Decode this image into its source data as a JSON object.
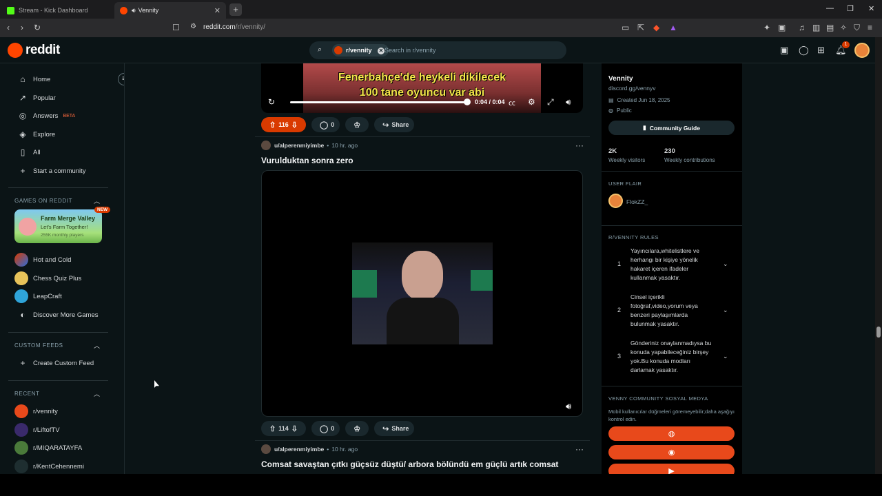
{
  "browser": {
    "tabs": [
      {
        "label": "Stream - Kick Dashboard",
        "favicon_color": "#53fc18"
      },
      {
        "label": "Vennity",
        "favicon_color": "#ff4500"
      }
    ],
    "new_tab": "+",
    "window_controls": {
      "minimize": "—",
      "restore": "❐",
      "close": "✕"
    },
    "url_host": "reddit.com",
    "url_path": "/r/vennity/"
  },
  "header": {
    "logo_text": "reddit",
    "search_chip": "r/vennity",
    "search_placeholder": "Search in r/vennity",
    "notification_count": "1"
  },
  "sidebar": {
    "nav": [
      {
        "label": "Home",
        "icon": "home-icon"
      },
      {
        "label": "Popular",
        "icon": "popular-icon"
      },
      {
        "label": "Answers",
        "icon": "answers-icon",
        "badge": "BETA"
      },
      {
        "label": "Explore",
        "icon": "explore-icon"
      },
      {
        "label": "All",
        "icon": "all-icon"
      },
      {
        "label": "Start a community",
        "icon": "plus-icon"
      }
    ],
    "games_title": "GAMES ON REDDIT",
    "featured_game": {
      "title": "Farm Merge Valley",
      "tagline": "Let's Farm Together!",
      "players": "255K monthly players",
      "badge": "NEW"
    },
    "games": [
      "Hot and Cold",
      "Chess Quiz Plus",
      "LeapCraft",
      "Discover More Games"
    ],
    "custom_feeds_title": "CUSTOM FEEDS",
    "create_feed": "Create Custom Feed",
    "recent_title": "RECENT",
    "recent": [
      "r/vennity",
      "r/LiftofTV",
      "r/MIQARATAYFA",
      "r/KentCehennemi"
    ]
  },
  "feed": {
    "video1": {
      "caption_line1": "Fenerbahçe'de heykeli dikilecek",
      "caption_line2": "100 tane oyuncu var abi",
      "time": "0:04 / 0:04",
      "progress": 1.0
    },
    "post1_actions": {
      "votes": "116",
      "comments": "0",
      "share": "Share"
    },
    "post2": {
      "author": "u/alperenmiyimbe",
      "age": "10 hr. ago",
      "title": "Vurulduktan sonra zero",
      "votes": "114",
      "comments": "0",
      "share": "Share"
    },
    "post3": {
      "author": "u/alperenmiyimbe",
      "age": "10 hr. ago",
      "title": "Comsat savaştan çıtkı güçsüz düştü/ arbora bölündü em güçlü artık comsat"
    }
  },
  "rightbar": {
    "name": "Vennity",
    "link": "discord.gg/vennyv",
    "created": "Created Jun 18, 2025",
    "visibility": "Public",
    "guide_button": "Community Guide",
    "stats": [
      {
        "value": "2K",
        "label": "Weekly visitors"
      },
      {
        "value": "230",
        "label": "Weekly contributions"
      }
    ],
    "user_flair_title": "USER FLAIR",
    "user_flair_name": "FlokZZ_",
    "rules_title": "R/VENNITY RULES",
    "rules": [
      {
        "num": "1",
        "text": "Yayıncılara,whitelistlere ve herhangı bir kişiye yönelik hakaret içeren ifadeler kullanmak yasaktır."
      },
      {
        "num": "2",
        "text": "Cinsel içerikli fotoğraf,video,yorum veya benzeri paylaşımlarda bulunmak yasaktır."
      },
      {
        "num": "3",
        "text": "Gönderiniz onaylanmadıysa bu konuda yapabileceğiniz birşey yok.Bu konuda modları darlamak yasaktır."
      }
    ],
    "social_title": "VENNY COMMUNITY SOSYAL MEDYA",
    "social_note": "Mobil kullanıcılar düğmeleri göremeyebilir;daha aşağıyı kontrol edin.",
    "social_buttons": [
      "globe-icon",
      "discord-icon",
      "youtube-icon"
    ]
  }
}
